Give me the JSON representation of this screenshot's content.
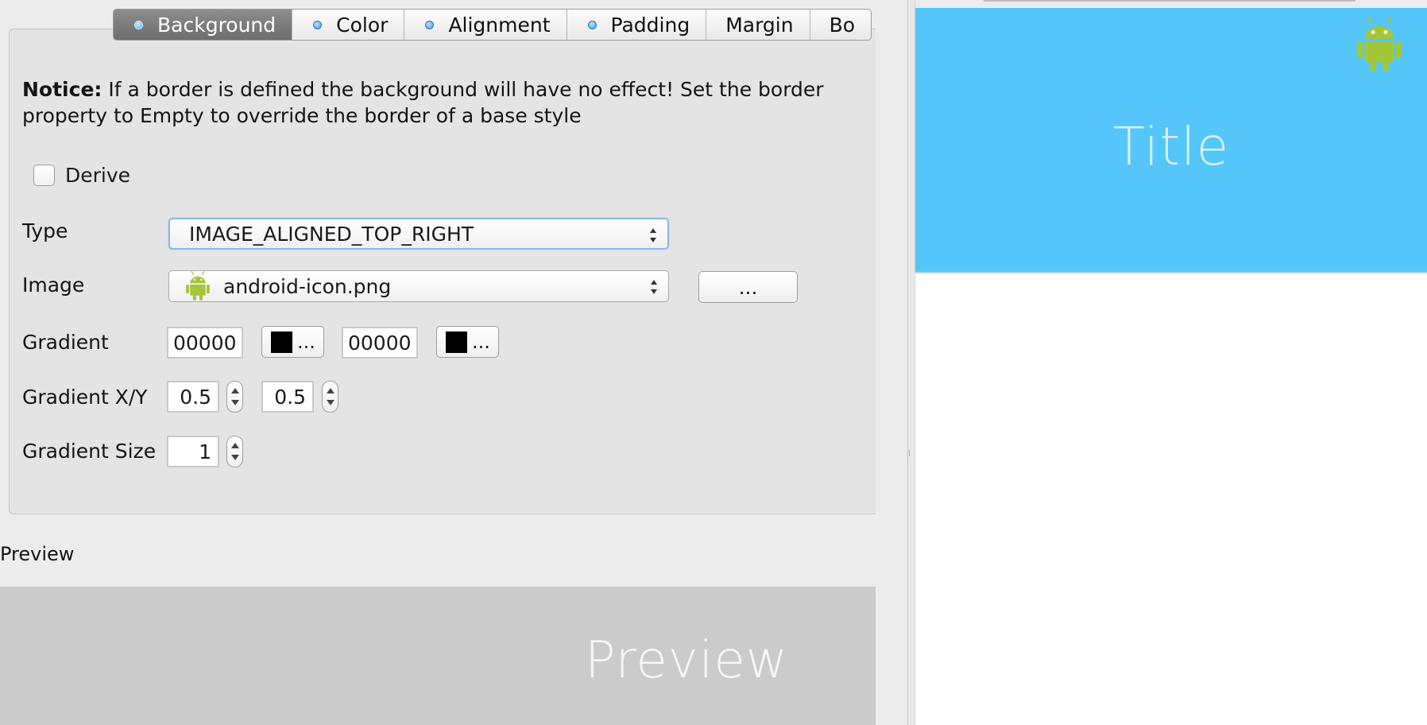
{
  "tabs": [
    {
      "label": "Background",
      "dot": true,
      "selected": true
    },
    {
      "label": "Color",
      "dot": true,
      "selected": false
    },
    {
      "label": "Alignment",
      "dot": true,
      "selected": false
    },
    {
      "label": "Padding",
      "dot": true,
      "selected": false
    },
    {
      "label": "Margin",
      "dot": false,
      "selected": false
    },
    {
      "label": "Bo",
      "dot": false,
      "selected": false
    }
  ],
  "notice": {
    "bold": "Notice:",
    "text": " If a border is defined the background will have no effect! Set the border property to Empty to override the border of a base style"
  },
  "derive": {
    "label": "Derive",
    "checked": false
  },
  "type": {
    "label": "Type",
    "value": "IMAGE_ALIGNED_TOP_RIGHT"
  },
  "image": {
    "label": "Image",
    "value": "android-icon.png",
    "browse_label": "...",
    "icon": "android-icon"
  },
  "gradient": {
    "label": "Gradient",
    "start_value": "00000",
    "start_button": "...",
    "end_value": "00000",
    "end_button": "...",
    "swatch_color": "#000000"
  },
  "gradient_xy": {
    "label": "Gradient X/Y",
    "x": "0.5",
    "y": "0.5"
  },
  "gradient_size": {
    "label": "Gradient Size",
    "value": "1"
  },
  "preview": {
    "label": "Preview",
    "text": "Preview"
  },
  "device_preview": {
    "title": "Title",
    "bar_color": "#55c6fa",
    "icon": "android-icon"
  },
  "colors": {
    "android_green": "#a4c639",
    "selected_tab": "#7a7a7a",
    "preview_bg": "#cbcbcb"
  }
}
